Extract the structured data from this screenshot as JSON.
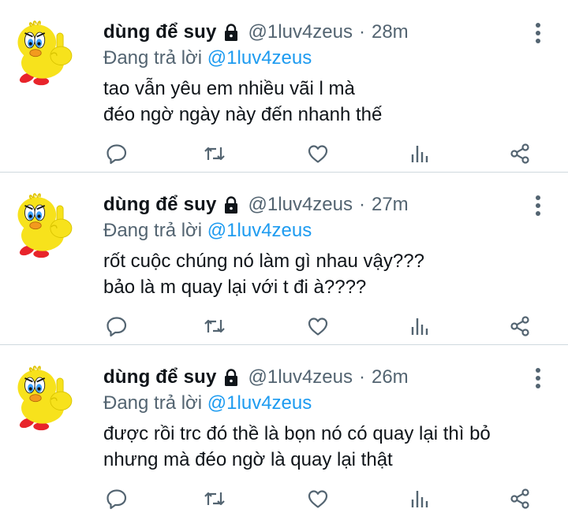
{
  "tweets": [
    {
      "display_name": "dùng để suy",
      "handle": "@1luv4zeus",
      "separator": "·",
      "time": "28m",
      "replying_prefix": "Đang trả lời",
      "replying_to": "@1luv4zeus",
      "lines": [
        "tao vẫn yêu em nhiều vãi l mà",
        "đéo ngờ ngày này đến nhanh thế"
      ]
    },
    {
      "display_name": "dùng để suy",
      "handle": "@1luv4zeus",
      "separator": "·",
      "time": "27m",
      "replying_prefix": "Đang trả lời",
      "replying_to": "@1luv4zeus",
      "lines": [
        "rốt cuộc chúng nó làm gì nhau vậy???",
        "bảo là m quay lại với t đi à????"
      ]
    },
    {
      "display_name": "dùng để suy",
      "handle": "@1luv4zeus",
      "separator": "·",
      "time": "26m",
      "replying_prefix": "Đang trả lời",
      "replying_to": "@1luv4zeus",
      "lines": [
        "được rồi trc đó thề là bọn nó có quay lại thì bỏ",
        "nhưng mà đéo ngờ là quay lại thật"
      ]
    }
  ],
  "icons": {
    "avatar": "tweety-bird-avatar",
    "lock": "lock-icon",
    "more": "more-vertical-icon",
    "actions": [
      "reply-icon",
      "retweet-icon",
      "like-icon",
      "analytics-icon",
      "share-icon"
    ]
  },
  "colors": {
    "text_primary": "#0f1419",
    "text_secondary": "#536471",
    "mention": "#1d9bf0",
    "divider": "#cfd9de"
  }
}
